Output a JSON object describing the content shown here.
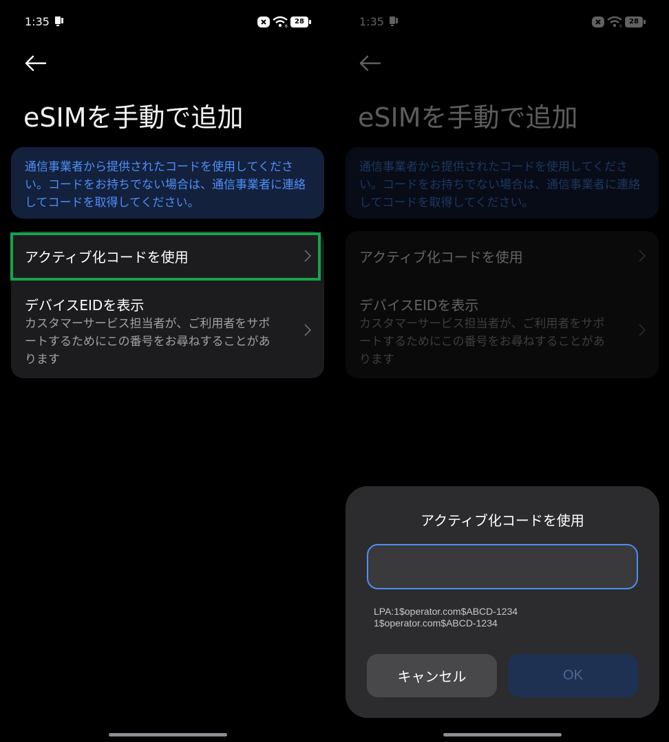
{
  "status_bar": {
    "time": "1:35",
    "battery": "28"
  },
  "page": {
    "title": "eSIMを手動で追加",
    "info_text": "通信事業者から提供されたコードを使用してください。コードをお持ちでない場合は、通信事業者に連絡してコードを取得してください。"
  },
  "menu": {
    "activation_code": {
      "label": "アクティブ化コードを使用"
    },
    "device_eid": {
      "label": "デバイスEIDを表示",
      "description": "カスタマーサービス担当者が、ご利用者をサポートするためにこの番号をお尋ねすることがあります"
    }
  },
  "dialog": {
    "title": "アクティブ化コードを使用",
    "input_value": "",
    "hint_line1": "LPA:1$operator.com$ABCD-1234",
    "hint_line2": "1$operator.com$ABCD-1234",
    "cancel_label": "キャンセル",
    "ok_label": "OK"
  },
  "colors": {
    "accent": "#4f8ef7",
    "highlight": "#16a34a",
    "card": "#1c1c1e",
    "info_card": "#13213d",
    "dialog": "#2c2c2e"
  },
  "icons": {
    "back": "arrow-left-icon",
    "chevron": "chevron-right-icon",
    "wifi": "wifi-icon",
    "battery": "battery-icon",
    "notification": "notification-icon",
    "no-sim": "x-box-icon"
  }
}
